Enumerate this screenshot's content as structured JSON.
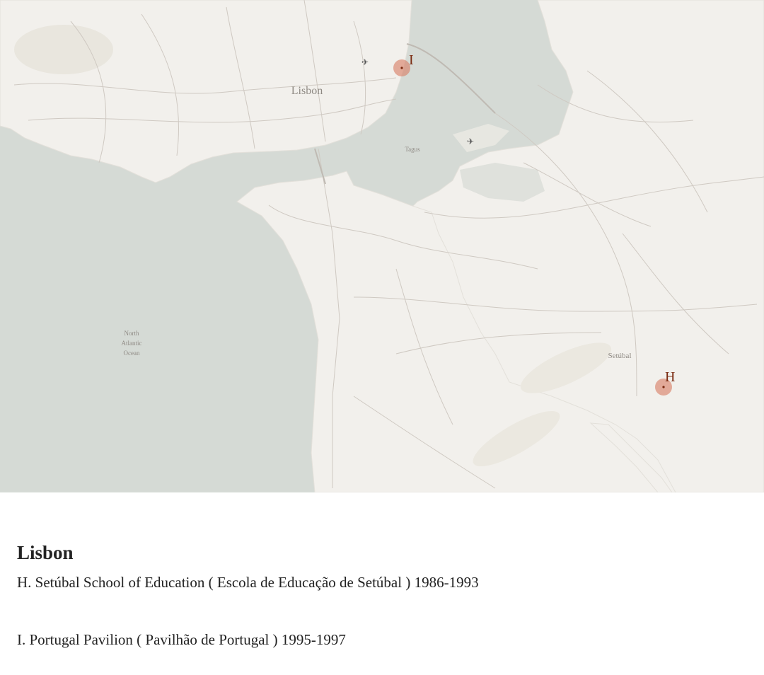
{
  "map": {
    "labels": {
      "lisbon": "Lisbon",
      "tagus": "Tagus",
      "setubal": "Setúbal",
      "ocean_line1": "North",
      "ocean_line2": "Atlantic",
      "ocean_line3": "Ocean"
    },
    "markers": {
      "h": "H",
      "i": "I"
    },
    "colors": {
      "water": "#d5dad5",
      "land": "#f2f0ec",
      "roads": "#c9c3bc",
      "marker": "#d9826b",
      "marker_text": "#7a2a10"
    }
  },
  "caption": {
    "title": "Lisbon",
    "item_h": "H. Setúbal School of Education ( Escola de Educação de Setúbal )  1986-1993",
    "item_i": "I. Portugal Pavilion ( Pavilhão de Portugal ) 1995-1997"
  }
}
